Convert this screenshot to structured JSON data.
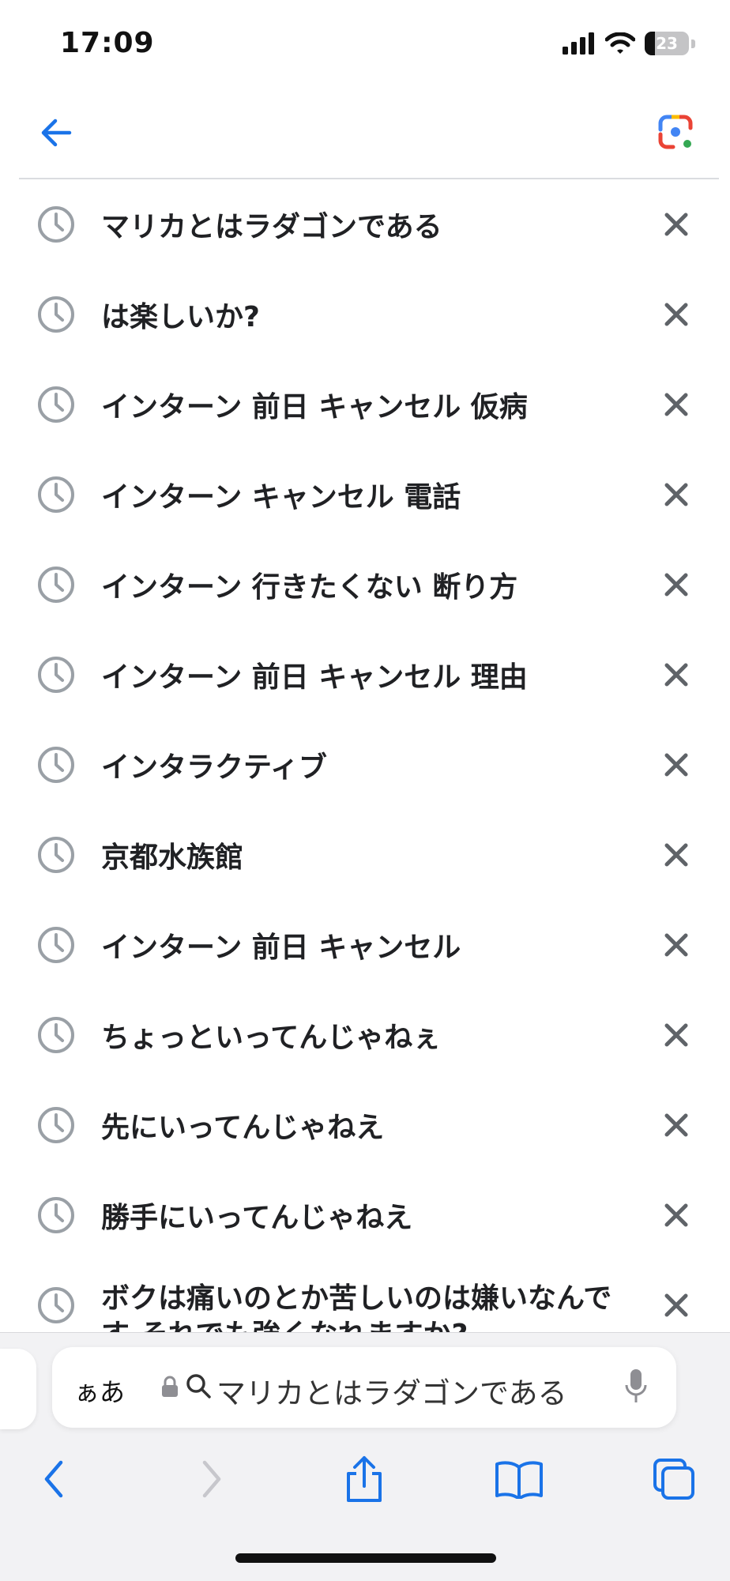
{
  "status_bar": {
    "time": "17:09",
    "battery_level": "23"
  },
  "history_items": [
    {
      "label": "マリカとはラダゴンである"
    },
    {
      "label": "は楽しいか?"
    },
    {
      "label": "インターン 前日 キャンセル 仮病"
    },
    {
      "label": "インターン キャンセル 電話"
    },
    {
      "label": "インターン 行きたくない 断り方"
    },
    {
      "label": "インターン 前日 キャンセル 理由"
    },
    {
      "label": "インタラクティブ"
    },
    {
      "label": "京都水族館"
    },
    {
      "label": "インターン 前日 キャンセル"
    },
    {
      "label": "ちょっといってんじゃねぇ"
    },
    {
      "label": "先にいってんじゃねえ"
    },
    {
      "label": "勝手にいってんじゃねえ"
    },
    {
      "label": "ボクは痛いのとか苦しいのは嫌いなんです それでも強くなれますか?"
    }
  ],
  "address_bar": {
    "text_size_label": "ぁあ",
    "query": "マリカとはラダゴンである"
  },
  "colors": {
    "accent": "#1a73e8",
    "clock_gray": "#9aa0a6",
    "x_gray": "#5f6368",
    "disabled": "#c7c7cc"
  },
  "icons": [
    "back-arrow-icon",
    "google-lens-icon",
    "clock-icon",
    "close-icon",
    "lock-icon",
    "search-icon",
    "microphone-icon",
    "chevron-left-icon",
    "chevron-right-icon",
    "share-icon",
    "bookmarks-icon",
    "tabs-icon"
  ]
}
